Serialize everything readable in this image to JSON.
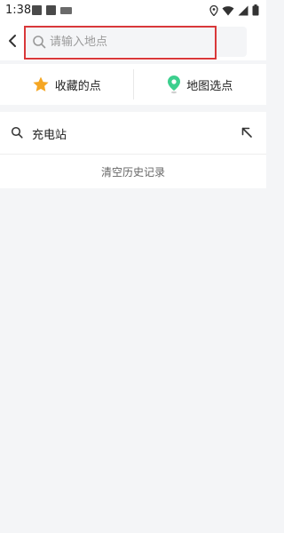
{
  "status_bar": {
    "time": "1:38",
    "icons": [
      "image-icon",
      "text-a-icon",
      "keyboard-icon",
      "location-icon",
      "wifi-icon",
      "signal-icon",
      "battery-icon"
    ]
  },
  "search": {
    "placeholder": "请输入地点",
    "value": ""
  },
  "quick_actions": {
    "favorites_label": "收藏的点",
    "map_pick_label": "地图选点",
    "favorites_icon": "star-icon",
    "map_pick_icon": "map-pin-icon"
  },
  "history": {
    "items": [
      {
        "label": "充电站"
      }
    ],
    "clear_label": "清空历史记录"
  },
  "colors": {
    "highlight": "#d9383a",
    "star": "#f5a623",
    "pin": "#3ccf8e",
    "background": "#f4f5f7"
  }
}
